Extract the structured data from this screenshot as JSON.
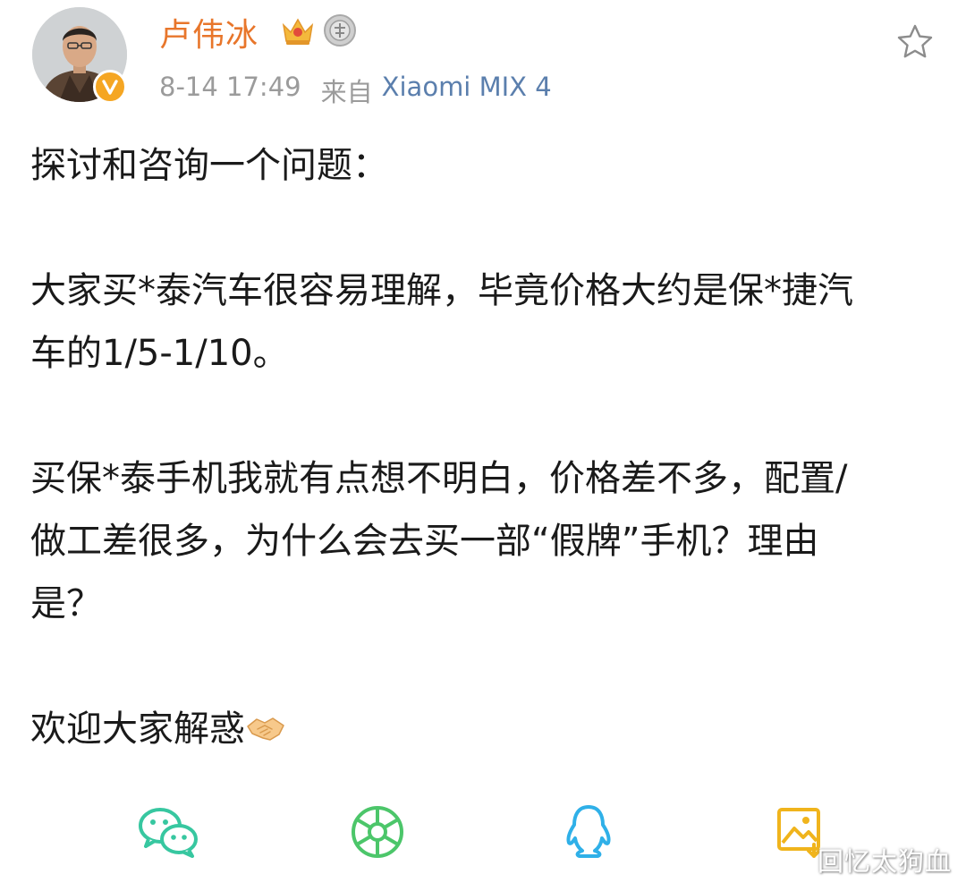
{
  "post": {
    "author": {
      "name": "卢伟冰",
      "avatar_icon": "avatar-photo",
      "badges": [
        "crown-badge-icon",
        "medal-badge-icon",
        "verified-icon"
      ]
    },
    "timestamp": "8-14 17:49",
    "source_prefix": "来自",
    "source_device": "Xiaomi MIX 4",
    "paragraphs": [
      [
        "探讨和咨询一个问题："
      ],
      [
        "大家买*泰汽车很容易理解，毕竟价格大约是保*捷汽",
        "车的1/5-1/10。"
      ],
      [
        "买保*泰手机我就有点想不明白，价格差不多，配置/",
        "做工差很多，为什么会去买一部“假牌”手机？理由",
        "是？"
      ],
      [
        "欢迎大家解惑"
      ]
    ],
    "end_emoji": "handshake-emoji"
  },
  "share": {
    "items": [
      "wechat-icon",
      "moments-icon",
      "qq-icon",
      "save-image-icon"
    ]
  },
  "watermark": "回忆太狗血",
  "colors": {
    "username": "#e8762b",
    "device_link": "#5b7fad",
    "meta_gray": "#9b9b9b",
    "wechat": "#37c7a0",
    "moments": "#4cc66a",
    "qq": "#2fb0e8",
    "save": "#f0b41c"
  }
}
